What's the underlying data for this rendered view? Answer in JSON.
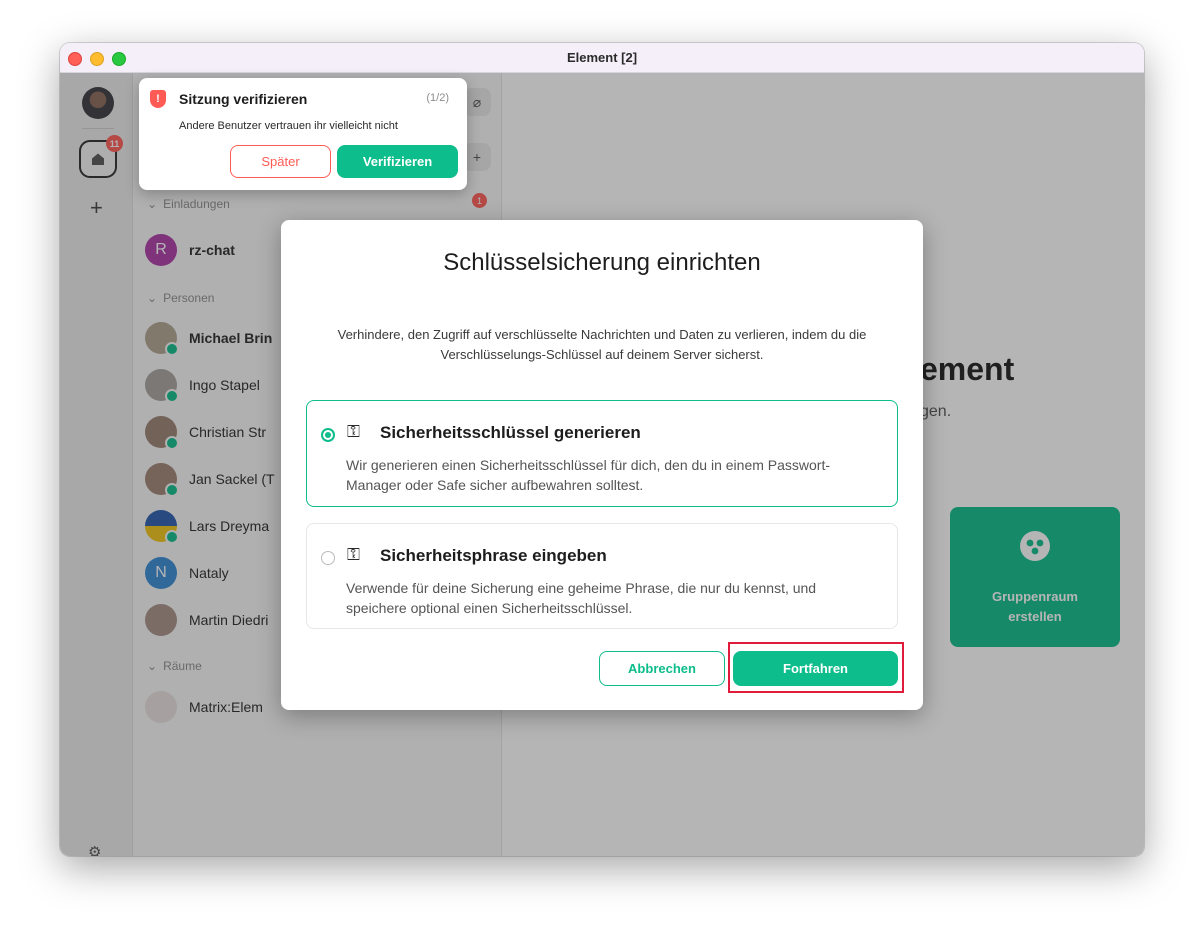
{
  "window": {
    "title": "Element [2]"
  },
  "spacebar": {
    "home_badge": "11"
  },
  "toast": {
    "title": "Sitzung verifizieren",
    "count": "(1/2)",
    "description": "Andere Benutzer vertrauen ihr vielleicht nicht",
    "later_label": "Später",
    "verify_label": "Verifizieren"
  },
  "roomlist": {
    "sections": {
      "invites": "Einladungen",
      "people": "Personen",
      "rooms": "Räume"
    },
    "invite_badge": "1",
    "invites": [
      {
        "name": "rz-chat",
        "initial": "R",
        "color": "#ac3ba8"
      }
    ],
    "people": [
      {
        "name": "Michael Brin"
      },
      {
        "name": "Ingo Stapel"
      },
      {
        "name": "Christian Str"
      },
      {
        "name": "Jan Sackel (T"
      },
      {
        "name": "Lars Dreyma"
      },
      {
        "name": "Nataly",
        "initial": "N",
        "color": "#368bd6"
      },
      {
        "name": "Martin Diedri"
      }
    ],
    "rooms": [
      {
        "name": "Matrix:Elem"
      }
    ]
  },
  "main": {
    "welcome_title": "ement",
    "welcome_sub": "gen.",
    "group_card_label": "Gruppenraum erstellen"
  },
  "dialog": {
    "title": "Schlüsselsicherung einrichten",
    "description": "Verhindere, den Zugriff auf verschlüsselte Nachrichten und Daten zu verlieren, indem du die Verschlüsselungs-Schlüssel auf deinem Server sicherst.",
    "options": [
      {
        "title": "Sicherheitsschlüssel generieren",
        "description": "Wir generieren einen Sicherheitsschlüssel für dich, den du in einem Passwort-Manager oder Safe sicher aufbewahren solltest.",
        "selected": true
      },
      {
        "title": "Sicherheitsphrase eingeben",
        "description": "Verwende für deine Sicherung eine geheime Phrase, die nur du kennst, und speichere optional einen Sicherheitsschlüssel.",
        "selected": false
      }
    ],
    "cancel_label": "Abbrechen",
    "continue_label": "Fortfahren"
  },
  "colors": {
    "accent": "#0dbd8b",
    "alert": "#ff5b55",
    "highlight": "#e01b3c"
  }
}
